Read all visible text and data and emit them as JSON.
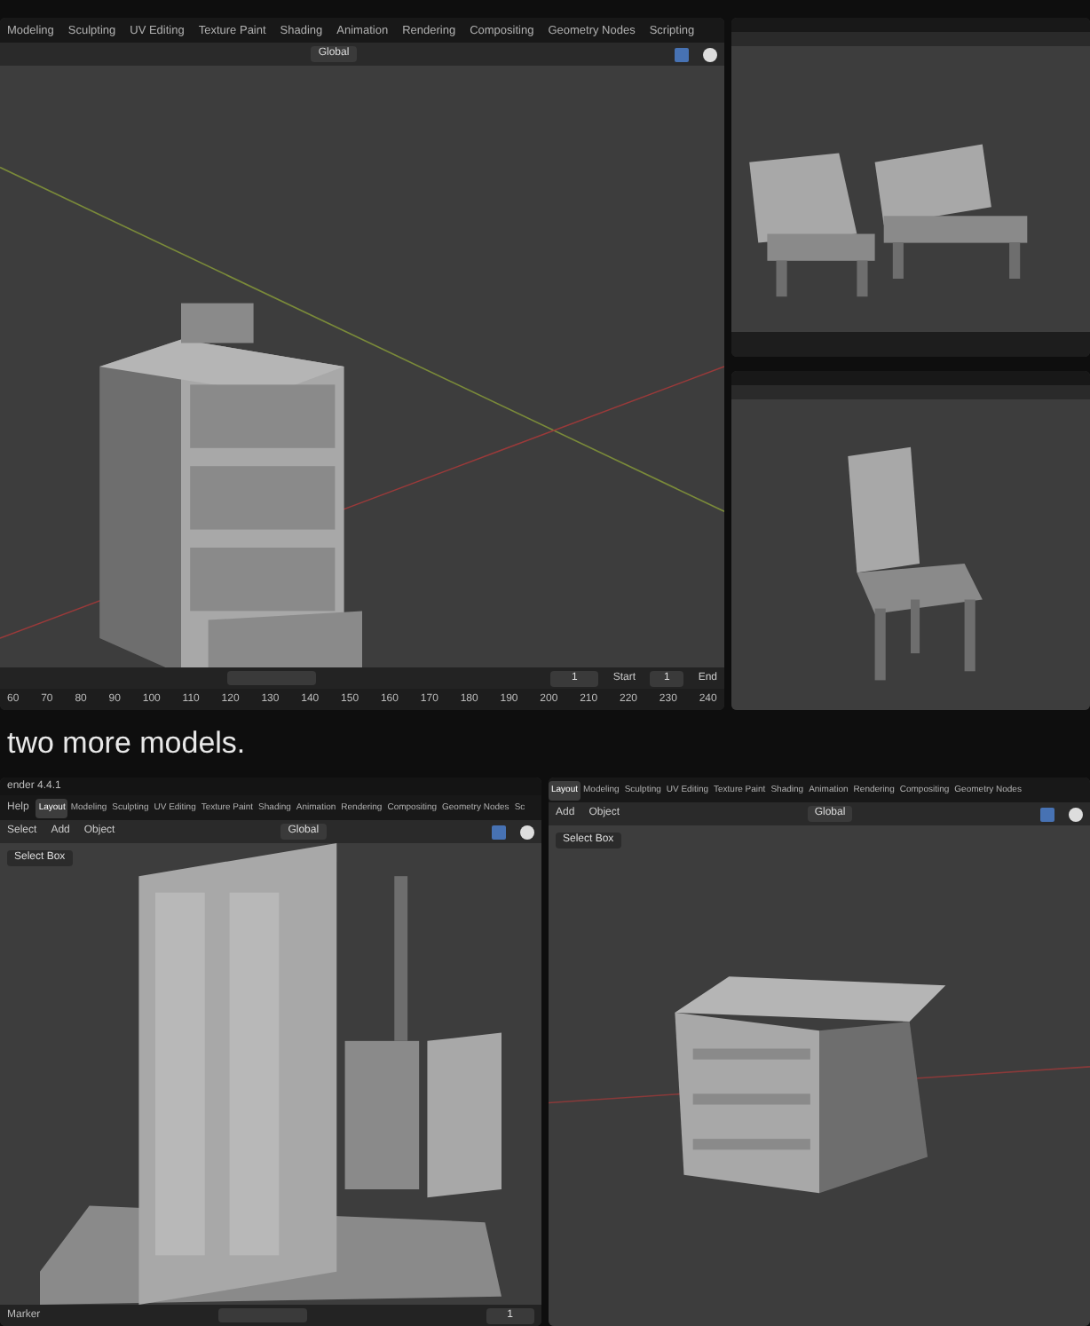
{
  "top_windows": [
    {
      "kind": "full",
      "tabs": [
        {
          "label": "Modeling",
          "selected": false
        },
        {
          "label": "Sculpting",
          "selected": false
        },
        {
          "label": "UV Editing",
          "selected": false
        },
        {
          "label": "Texture Paint",
          "selected": false
        },
        {
          "label": "Shading",
          "selected": false
        },
        {
          "label": "Animation",
          "selected": false
        },
        {
          "label": "Rendering",
          "selected": false
        },
        {
          "label": "Compositing",
          "selected": false
        },
        {
          "label": "Geometry Nodes",
          "selected": false
        },
        {
          "label": "Scripting",
          "selected": false
        }
      ],
      "orientation": "Global",
      "frame": "1",
      "start_label": "Start",
      "start": "1",
      "end_label": "End",
      "ruler": [
        "60",
        "70",
        "80",
        "90",
        "100",
        "110",
        "120",
        "130",
        "140",
        "150",
        "160",
        "170",
        "180",
        "190",
        "200",
        "210",
        "220",
        "230",
        "240"
      ]
    },
    {
      "kind": "mini"
    },
    {
      "kind": "mini"
    }
  ],
  "caption": "two more models.",
  "bottom_windows": [
    {
      "title": "ender 4.4.1",
      "app_menu": "Help",
      "tabs": [
        {
          "label": "Layout",
          "selected": true
        },
        {
          "label": "Modeling",
          "selected": false
        },
        {
          "label": "Sculpting",
          "selected": false
        },
        {
          "label": "UV Editing",
          "selected": false
        },
        {
          "label": "Texture Paint",
          "selected": false
        },
        {
          "label": "Shading",
          "selected": false
        },
        {
          "label": "Animation",
          "selected": false
        },
        {
          "label": "Rendering",
          "selected": false
        },
        {
          "label": "Compositing",
          "selected": false
        },
        {
          "label": "Geometry Nodes",
          "selected": false
        },
        {
          "label": "Sc",
          "selected": false
        }
      ],
      "menus": [
        "Select",
        "Add",
        "Object"
      ],
      "orientation": "Global",
      "tool": "Select Box",
      "marker": "Marker",
      "frame": "1"
    },
    {
      "tabs": [
        {
          "label": "Layout",
          "selected": true
        },
        {
          "label": "Modeling",
          "selected": false
        },
        {
          "label": "Sculpting",
          "selected": false
        },
        {
          "label": "UV Editing",
          "selected": false
        },
        {
          "label": "Texture Paint",
          "selected": false
        },
        {
          "label": "Shading",
          "selected": false
        },
        {
          "label": "Animation",
          "selected": false
        },
        {
          "label": "Rendering",
          "selected": false
        },
        {
          "label": "Compositing",
          "selected": false
        },
        {
          "label": "Geometry Nodes",
          "selected": false
        }
      ],
      "menus": [
        "Add",
        "Object"
      ],
      "orientation": "Global",
      "tool": "Select Box"
    }
  ]
}
